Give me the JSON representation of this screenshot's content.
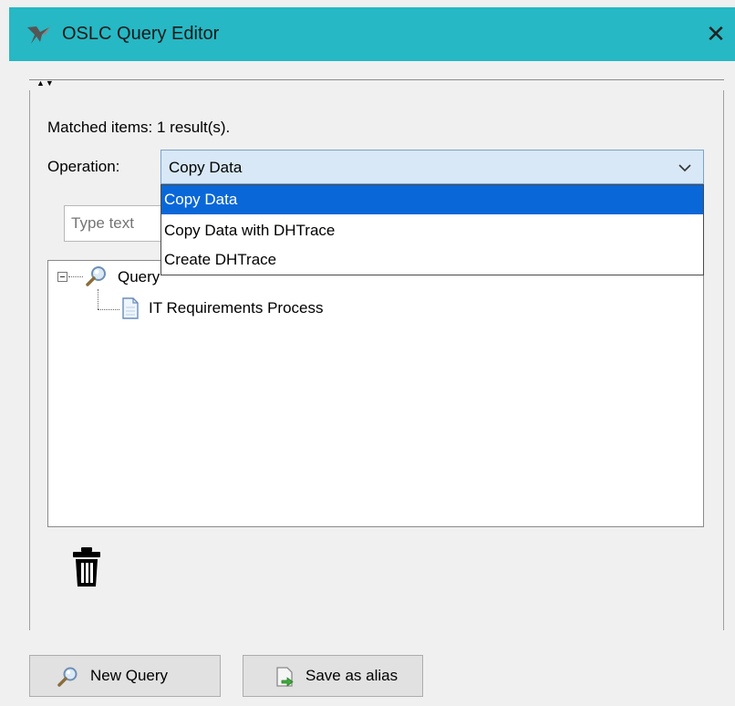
{
  "window": {
    "title": "OSLC Query Editor",
    "close_glyph": "✕"
  },
  "splitter": {
    "arrows": "▲▼"
  },
  "status": {
    "matched": "Matched items: 1 result(s)."
  },
  "operation": {
    "label": "Operation:",
    "selected": "Copy Data",
    "options": [
      "Copy Data",
      "Copy Data with DHTrace",
      "Create DHTrace"
    ],
    "highlighted_index": 0
  },
  "filter": {
    "placeholder": "Type text"
  },
  "tree": {
    "root": {
      "label": "Query",
      "icon": "magnifier-icon",
      "expanded": true
    },
    "children": [
      {
        "label": "IT Requirements Process",
        "icon": "document-icon"
      }
    ]
  },
  "actions": {
    "delete_icon": "trash-icon",
    "new_query": {
      "label": "New Query",
      "icon": "magnifier-icon"
    },
    "save_alias": {
      "label": "Save as alias",
      "icon": "save-alias-icon"
    }
  },
  "colors": {
    "titlebar": "#26b8c4",
    "combo_bg": "#d8e8f6",
    "selection": "#0a67d8"
  }
}
